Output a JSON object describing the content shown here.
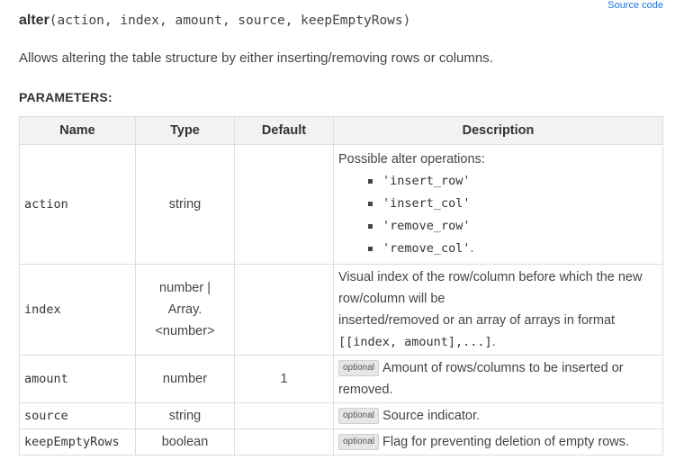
{
  "source_link": "Source code",
  "method": {
    "name": "alter",
    "params_signature": "(action, index, amount, source, keepEmptyRows)",
    "description": "Allows altering the table structure by either inserting/removing rows or columns."
  },
  "parameters_heading": "PARAMETERS:",
  "table": {
    "headers": {
      "name": "Name",
      "type": "Type",
      "default": "Default",
      "description": "Description"
    },
    "rows": [
      {
        "name": "action",
        "type": "string",
        "default": "",
        "desc_intro": "Possible alter operations:",
        "ops": [
          "'insert_row'",
          "'insert_col'",
          "'remove_row'",
          "'remove_col'"
        ],
        "ops_trailing": "."
      },
      {
        "name": "index",
        "type_lines": [
          "number |",
          "Array.",
          "<number>"
        ],
        "default": "",
        "desc_lines": [
          "Visual index of the row/column before which the new",
          "row/column will be",
          "inserted/removed or an array of arrays in format"
        ],
        "desc_code": "[[index, amount],...]",
        "desc_code_trailing": "."
      },
      {
        "name": "amount",
        "type": "number",
        "default": "1",
        "badge": "optional",
        "desc_first": "Amount of rows/columns to be inserted or",
        "desc_second": "removed."
      },
      {
        "name": "source",
        "type": "string",
        "default": "",
        "badge": "optional",
        "desc": "Source indicator."
      },
      {
        "name": "keepEmptyRows",
        "type": "boolean",
        "default": "",
        "badge": "optional",
        "desc": "Flag for preventing deletion of empty rows."
      }
    ]
  }
}
